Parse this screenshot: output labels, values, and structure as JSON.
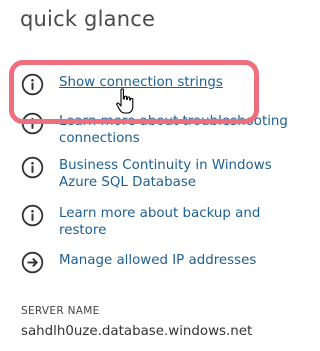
{
  "panel": {
    "title": "quick glance"
  },
  "links": [
    {
      "label": "Show connection strings",
      "icon": "info-icon"
    },
    {
      "label": "Learn more about troubleshooting connections",
      "icon": "info-icon"
    },
    {
      "label": "Business Continuity in Windows Azure SQL Database",
      "icon": "info-icon"
    },
    {
      "label": "Learn more about backup and restore",
      "icon": "info-icon"
    },
    {
      "label": "Manage allowed IP addresses",
      "icon": "arrow-right-icon"
    }
  ],
  "server": {
    "label": "SERVER NAME",
    "value": "sahdlh0uze.database.windows.net"
  },
  "colors": {
    "link": "#1e5f90",
    "icon": "#333333",
    "highlight": "#ef6e7e"
  }
}
